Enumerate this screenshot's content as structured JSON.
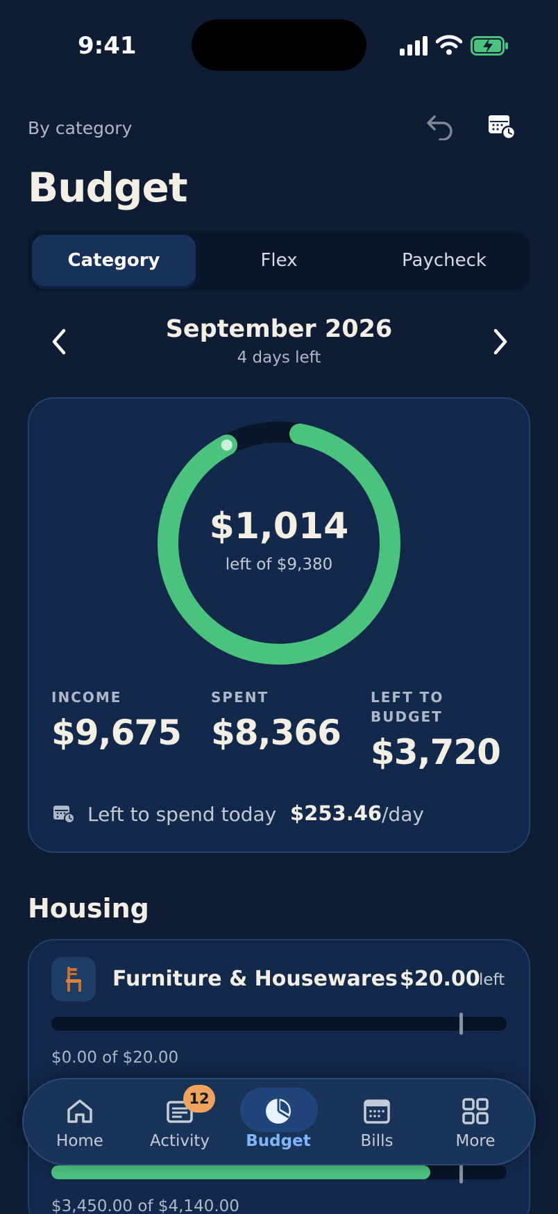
{
  "status_bar": {
    "time": "9:41"
  },
  "header": {
    "subtitle": "By category",
    "title": "Budget"
  },
  "segments": [
    {
      "label": "Category",
      "active": true
    },
    {
      "label": "Flex",
      "active": false
    },
    {
      "label": "Paycheck",
      "active": false
    }
  ],
  "period": {
    "month": "September 2026",
    "days_left": "4 days left"
  },
  "summary": {
    "ring": {
      "amount": "$1,014",
      "sub": "left of $9,380",
      "progress_fraction": 0.892
    },
    "stats": [
      {
        "label": "INCOME",
        "value": "$9,675"
      },
      {
        "label": "SPENT",
        "value": "$8,366"
      },
      {
        "label": "LEFT TO BUDGET",
        "value": "$3,720"
      }
    ],
    "daily": {
      "label": "Left to spend today",
      "amount": "$253.46",
      "unit": "/day"
    }
  },
  "housing": {
    "title": "Housing",
    "categories": [
      {
        "name": "Furniture & Housewares",
        "amount": "$20.00",
        "amount_suffix": "left",
        "detail_spent": "$0.00",
        "detail_of": "of",
        "detail_total": "$20.00",
        "progress_fraction": 0.0
      },
      {
        "detail_spent": "$3,450.00",
        "detail_of": "of",
        "detail_total": "$4,140.00",
        "progress_fraction": 0.833
      }
    ]
  },
  "tabbar": {
    "items": [
      {
        "label": "Home",
        "icon": "home-icon"
      },
      {
        "label": "Activity",
        "icon": "activity-icon",
        "badge": "12"
      },
      {
        "label": "Budget",
        "icon": "budget-pie-icon",
        "active": true
      },
      {
        "label": "Bills",
        "icon": "bills-calendar-icon"
      },
      {
        "label": "More",
        "icon": "grid-icon"
      }
    ]
  },
  "colors": {
    "background": "#0e1c34",
    "card": "#13294b",
    "accent_green": "#4cc27f",
    "active_tab": "#7fb6ff",
    "badge": "#f0a35e"
  }
}
